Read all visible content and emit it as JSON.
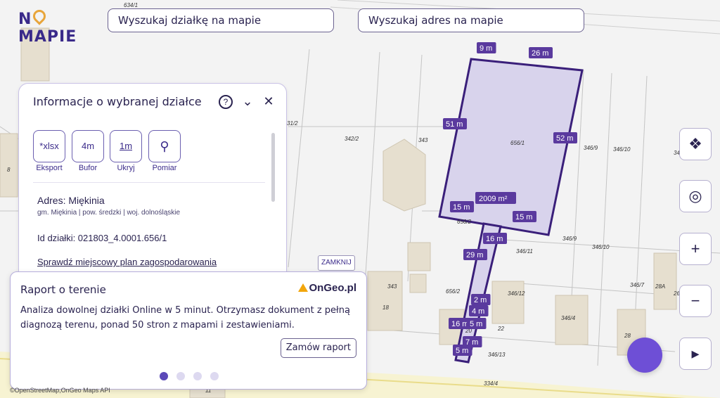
{
  "logo": {
    "text_left": "N",
    "text_right": "MAPIE"
  },
  "search": {
    "parcel": "Wyszukaj działkę na mapie",
    "address": "Wyszukaj adres na mapie"
  },
  "panel": {
    "title": "Informacje o wybranej działce",
    "help_icon": "?",
    "collapse_icon": "⌄",
    "close_icon": "✕",
    "tools": [
      {
        "value": "*xlsx",
        "label": "Eksport"
      },
      {
        "value": "4m",
        "label": "Bufor"
      },
      {
        "value": "1m",
        "label": "Ukryj"
      },
      {
        "value": "⚲",
        "label": "Pomiar"
      }
    ],
    "address": "Adres: Miękinia",
    "address_sub": "gm. Miękinia | pow. średzki | woj. dolnośląskie",
    "parcel_id": "Id działki: 021803_4.0001.656/1",
    "plan_link": "Sprawdź miejscowy plan zagospodarowania"
  },
  "close_link": "ZAMKNIJ",
  "report": {
    "title": "Raport o terenie",
    "brand": "OnGeo.pl",
    "text": "Analiza dowolnej działki Online w 5 minut. Otrzymasz dokument z pełną diagnozą terenu, ponad 50 stron z mapami i zestawieniami.",
    "button": "Zamów raport",
    "slides": 4,
    "active_slide": 0
  },
  "credit": "©OpenStreetMap,OnGeo Maps API",
  "map_controls": [
    {
      "name": "layers-icon",
      "glyph": "❖"
    },
    {
      "name": "locate-icon",
      "glyph": "◎"
    },
    {
      "name": "zoom-in-icon",
      "glyph": "+"
    },
    {
      "name": "zoom-out-icon",
      "glyph": "−"
    },
    {
      "name": "play-icon",
      "glyph": "▸"
    }
  ],
  "map": {
    "area_label": "2009 m²",
    "measurements": [
      "9 m",
      "26 m",
      "51 m",
      "52 m",
      "15 m",
      "15 m",
      "16 m",
      "29 m",
      "2 m",
      "4 m",
      "16 m",
      "5 m",
      "7 m",
      "5 m"
    ],
    "parcel_numbers": [
      "634/1",
      "656/1",
      "342/2",
      "343",
      "346/9",
      "346/10",
      "346/5",
      "656/2",
      "346/11",
      "346/9",
      "346/10",
      "343",
      "656/2",
      "346/12",
      "346/4",
      "346/7",
      "346/13",
      "334/4",
      "18",
      "20",
      "22",
      "28",
      "28A",
      "26",
      "11",
      "8",
      "31/2"
    ],
    "accent": "#4b2e8c",
    "parcel_fill": "#d8d3ec"
  }
}
